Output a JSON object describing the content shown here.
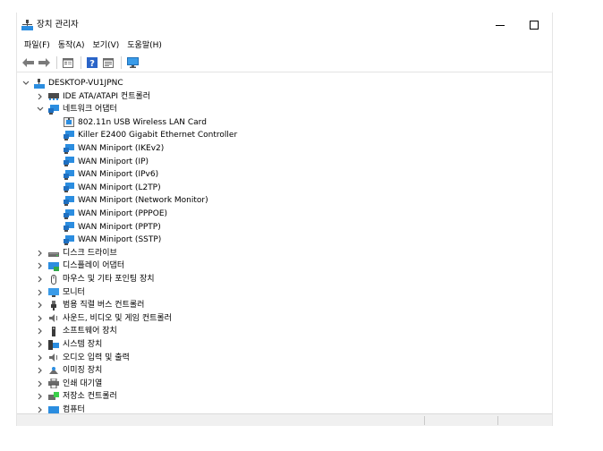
{
  "window": {
    "title": "장치 관리자"
  },
  "menu": [
    "파일(F)",
    "동작(A)",
    "보기(V)",
    "도움말(H)"
  ],
  "toolbar": {
    "buttons": [
      "back-arrow-icon",
      "forward-arrow-icon",
      "properties-icon",
      "help-icon",
      "view-icon",
      "monitor-icon"
    ]
  },
  "tree": {
    "root": "DESKTOP-VU1JPNC",
    "categories": [
      {
        "label": "IDE ATA/ATAPI 컨트롤러",
        "icon": "ide-controller-icon",
        "expanded": false
      },
      {
        "label": "네트워크 어댑터",
        "icon": "network-adapter-icon",
        "expanded": true,
        "children": [
          "802.11n USB Wireless LAN Card",
          "Killer E2400 Gigabit Ethernet Controller",
          "WAN Miniport (IKEv2)",
          "WAN Miniport (IP)",
          "WAN Miniport (IPv6)",
          "WAN Miniport (L2TP)",
          "WAN Miniport (Network Monitor)",
          "WAN Miniport (PPPOE)",
          "WAN Miniport (PPTP)",
          "WAN Miniport (SSTP)"
        ]
      },
      {
        "label": "디스크 드라이브",
        "icon": "disk-drive-icon",
        "expanded": false
      },
      {
        "label": "디스플레이 어댑터",
        "icon": "display-adapter-icon",
        "expanded": false
      },
      {
        "label": "마우스 및 기타 포인팅 장치",
        "icon": "mouse-icon",
        "expanded": false
      },
      {
        "label": "모니터",
        "icon": "monitor-icon",
        "expanded": false
      },
      {
        "label": "범용 직렬 버스 컨트롤러",
        "icon": "usb-icon",
        "expanded": false
      },
      {
        "label": "사운드, 비디오 및 게임 컨트롤러",
        "icon": "speaker-icon",
        "expanded": false
      },
      {
        "label": "소프트웨어 장치",
        "icon": "software-device-icon",
        "expanded": false
      },
      {
        "label": "시스템 장치",
        "icon": "system-device-icon",
        "expanded": false
      },
      {
        "label": "오디오 입력 및 출력",
        "icon": "audio-icon",
        "expanded": false
      },
      {
        "label": "이미징 장치",
        "icon": "camera-icon",
        "expanded": false
      },
      {
        "label": "인쇄 대기열",
        "icon": "printer-icon",
        "expanded": false
      },
      {
        "label": "저장소 컨트롤러",
        "icon": "storage-controller-icon",
        "expanded": false
      },
      {
        "label": "컴퓨터",
        "icon": "computer-icon",
        "expanded": false
      }
    ]
  },
  "colors": {
    "network_blue": "#2b8de0",
    "text": "#000000"
  }
}
